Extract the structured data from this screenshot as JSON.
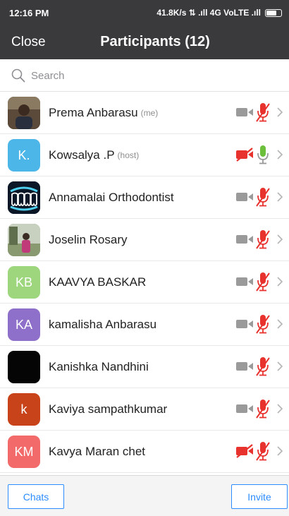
{
  "status_bar": {
    "time": "12:16 PM",
    "right": "41.8K/s ⇅ .ıll 4G VoLTE .ıll"
  },
  "header": {
    "close_label": "Close",
    "title": "Participants (12)"
  },
  "search": {
    "placeholder": "Search",
    "value": ""
  },
  "participants": [
    {
      "name": "Prema Anbarasu",
      "tag": "(me)",
      "avatar_initials": "",
      "avatar_type": "photo-person",
      "avatar_color": "#6b5a48",
      "video_on": false,
      "video_muted_red": false,
      "mic_muted": true
    },
    {
      "name": "Kowsalya .P",
      "tag": "(host)",
      "avatar_initials": "K.",
      "avatar_type": "initials",
      "avatar_color": "#4db6e8",
      "video_on": false,
      "video_muted_red": true,
      "mic_muted": false
    },
    {
      "name": "Annamalai Orthodontist",
      "tag": "",
      "avatar_initials": "",
      "avatar_type": "logo-teeth",
      "avatar_color": "#0d1a2b",
      "video_on": false,
      "video_muted_red": false,
      "mic_muted": true
    },
    {
      "name": "Joselin Rosary",
      "tag": "",
      "avatar_initials": "",
      "avatar_type": "photo-outdoor",
      "avatar_color": "#7a8c6a",
      "video_on": false,
      "video_muted_red": false,
      "mic_muted": true
    },
    {
      "name": "KAAVYA BASKAR",
      "tag": "",
      "avatar_initials": "KB",
      "avatar_type": "initials",
      "avatar_color": "#9dd67c",
      "video_on": false,
      "video_muted_red": false,
      "mic_muted": true
    },
    {
      "name": "kamalisha Anbarasu",
      "tag": "",
      "avatar_initials": "KA",
      "avatar_type": "initials",
      "avatar_color": "#8e6fc9",
      "video_on": false,
      "video_muted_red": false,
      "mic_muted": true
    },
    {
      "name": "Kanishka Nandhini",
      "tag": "",
      "avatar_initials": "",
      "avatar_type": "solid-black",
      "avatar_color": "#050505",
      "video_on": false,
      "video_muted_red": false,
      "mic_muted": true
    },
    {
      "name": "Kaviya sampathkumar",
      "tag": "",
      "avatar_initials": "k",
      "avatar_type": "initials",
      "avatar_color": "#c8431a",
      "video_on": false,
      "video_muted_red": false,
      "mic_muted": true
    },
    {
      "name": "Kavya Maran chet",
      "tag": "",
      "avatar_initials": "KM",
      "avatar_type": "initials",
      "avatar_color": "#f26a6a",
      "video_on": false,
      "video_muted_red": true,
      "mic_muted": true
    }
  ],
  "footer": {
    "chats_label": "Chats",
    "invite_label": "Invite"
  },
  "colors": {
    "header_bg": "#3a3a3d",
    "accent": "#2d8cff",
    "muted_red": "#e8322e",
    "mic_green": "#6bbf3a",
    "icon_gray": "#9a9a9a"
  },
  "icons": {
    "search": "search-icon",
    "camera": "camera-icon",
    "camera_off": "camera-off-icon",
    "mic": "microphone-icon",
    "mic_muted": "microphone-muted-icon",
    "chevron": "chevron-right-icon"
  }
}
